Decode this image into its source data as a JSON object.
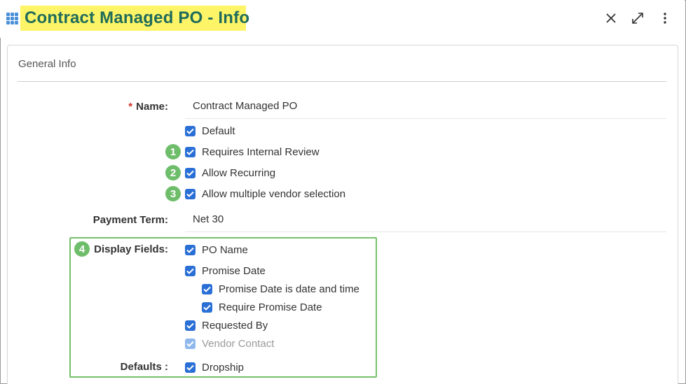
{
  "header": {
    "title": "Contract Managed PO - Info",
    "app_icon": "grid-icon",
    "close_icon": "close-icon",
    "expand_icon": "expand-icon",
    "more_icon": "more-vertical-icon"
  },
  "section": {
    "title": "General Info"
  },
  "form": {
    "name": {
      "required_mark": "*",
      "label": "Name:",
      "value": "Contract Managed PO"
    },
    "options": [
      {
        "label": "Default",
        "checked": true,
        "badge": ""
      },
      {
        "label": "Requires Internal Review",
        "checked": true,
        "badge": "1"
      },
      {
        "label": "Allow Recurring",
        "checked": true,
        "badge": "2"
      },
      {
        "label": "Allow multiple vendor selection",
        "checked": true,
        "badge": "3"
      }
    ],
    "payment_term": {
      "label": "Payment Term:",
      "value": "Net 30"
    },
    "display_fields": {
      "badge": "4",
      "label": "Display Fields:",
      "items": [
        {
          "label": "PO Name",
          "checked": true,
          "disabled": false
        },
        {
          "label": "Promise Date",
          "checked": true,
          "disabled": false
        },
        {
          "label": "Promise Date is date and time",
          "checked": true,
          "disabled": false
        },
        {
          "label": "Require Promise Date",
          "checked": true,
          "disabled": false
        },
        {
          "label": "Requested By",
          "checked": true,
          "disabled": false
        },
        {
          "label": "Vendor Contact",
          "checked": true,
          "disabled": true
        }
      ]
    },
    "defaults": {
      "label": "Defaults :",
      "items": [
        {
          "label": "Dropship",
          "checked": true
        }
      ]
    }
  },
  "colors": {
    "title_text": "#1f6b5a",
    "title_highlight": "#fdf567",
    "checkbox": "#2a6fd6",
    "checkbox_disabled": "#8fb8ec",
    "badge": "#6ebd6a",
    "callout_border": "#74c169",
    "required": "#d0312d"
  }
}
